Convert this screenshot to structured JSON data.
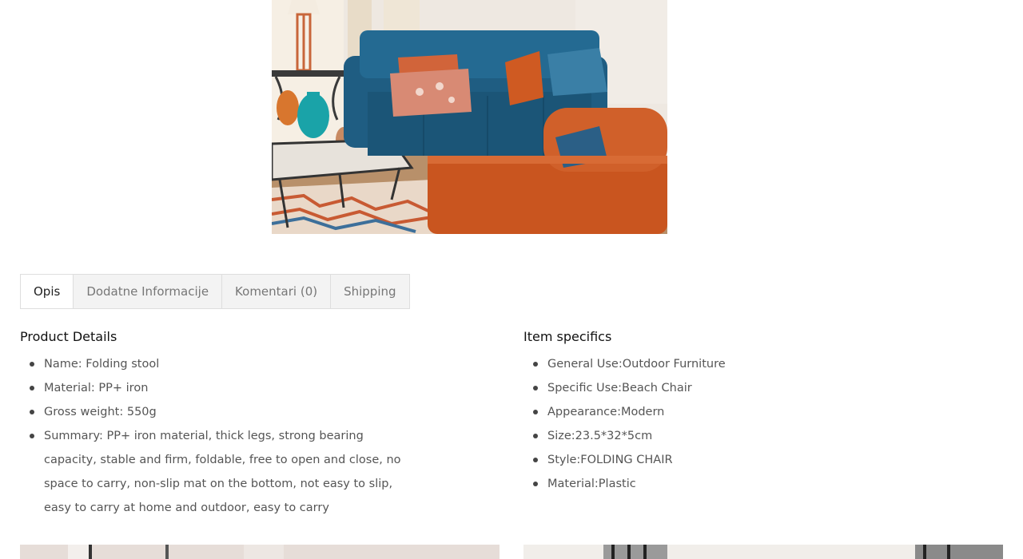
{
  "tabs": [
    {
      "label": "Opis",
      "active": true
    },
    {
      "label": "Dodatne Informacije",
      "active": false
    },
    {
      "label": "Komentari (0)",
      "active": false
    },
    {
      "label": "Shipping",
      "active": false
    }
  ],
  "product_details": {
    "heading": "Product Details",
    "items": [
      "Name: Folding stool",
      "Material: PP+ iron",
      "Gross weight: 550g",
      "Summary: PP+ iron material, thick legs, strong bearing capacity, stable and firm, foldable, free to open and close, no space to carry, non-slip mat on the bottom, not easy to slip, easy to carry at home and outdoor, easy to carry"
    ]
  },
  "item_specifics": {
    "heading": "Item specifics",
    "items": [
      "General Use:Outdoor Furniture",
      "Specific Use:Beach Chair",
      "Appearance:Modern",
      "Size:23.5*32*5cm",
      "Style:FOLDING CHAIR",
      "Material:Plastic"
    ]
  },
  "colors": {
    "accent_text": "#111111",
    "body_text": "#555555",
    "tab_border": "#dedede",
    "tab_inactive_bg": "#f3f3f3"
  }
}
